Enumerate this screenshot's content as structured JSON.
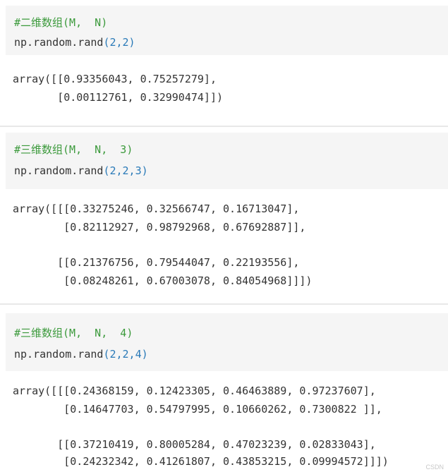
{
  "cells": [
    {
      "comment": "#二维数组(M,  N)",
      "code_prefix": "np.random.rand",
      "code_args": "(2,2)",
      "output": [
        "array([[0.93356043, 0.75257279],",
        "       [0.00112761, 0.32990474]])"
      ]
    },
    {
      "comment": "#三维数组(M,  N,  3)",
      "code_prefix": "np.random.rand",
      "code_args": "(2,2,3)",
      "output": [
        "array([[[0.33275246, 0.32566747, 0.16713047],",
        "        [0.82112927, 0.98792968, 0.67692887]],",
        "",
        "       [[0.21376756, 0.79544047, 0.22193556],",
        "        [0.08248261, 0.67003078, 0.84054968]]])"
      ]
    },
    {
      "comment": "#三维数组(M,  N,  4)",
      "code_prefix": "np.random.rand",
      "code_args": "(2,2,4)",
      "output": [
        "array([[[0.24368159, 0.12423305, 0.46463889, 0.97237607],",
        "        [0.14647703, 0.54797995, 0.10660262, 0.7300822 ]],",
        "",
        "       [[0.37210419, 0.80005284, 0.47023239, 0.02833043],",
        "        [0.24232342, 0.41261807, 0.43853215, 0.09994572]]])"
      ]
    }
  ],
  "watermark": "CSDN",
  "colors": {
    "input_bg": "#f5f5f5",
    "comment": "#3c9a3c",
    "number": "#2a7ab8",
    "text": "#333333"
  }
}
